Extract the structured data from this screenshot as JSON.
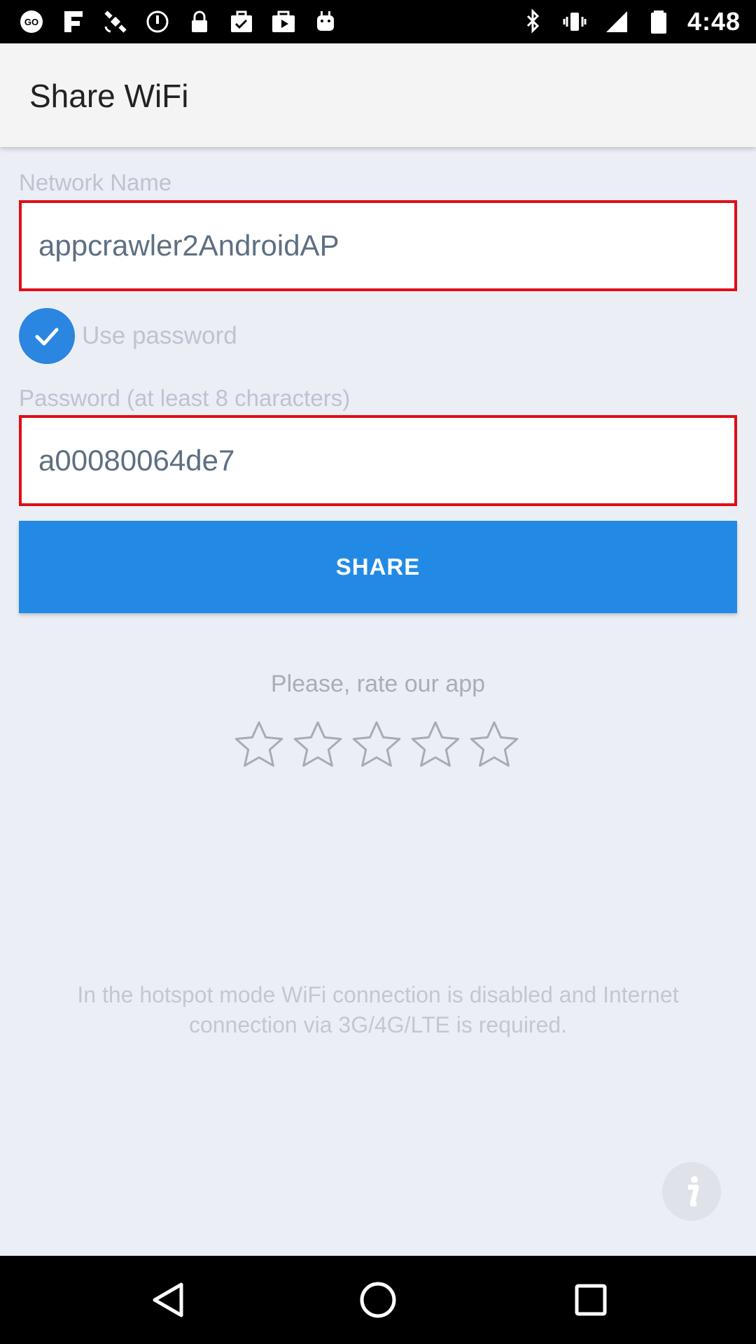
{
  "status_bar": {
    "time": "4:48",
    "left_icons": [
      "go-icon",
      "fake-gps-icon",
      "satellite-icon",
      "alarm-icon",
      "lock-icon",
      "briefcase-check-icon",
      "play-store-icon",
      "android-icon"
    ],
    "right_icons": [
      "bluetooth-icon",
      "vibrate-icon",
      "signal-icon",
      "battery-icon"
    ]
  },
  "app_bar": {
    "title": "Share WiFi"
  },
  "form": {
    "network_label": "Network Name",
    "network_value": "appcrawler2AndroidAP",
    "use_password_label": "Use password",
    "use_password_checked": true,
    "password_label": "Password (at least 8 characters)",
    "password_value": "a00080064de7",
    "share_button": "SHARE"
  },
  "rating": {
    "label": "Please, rate our app",
    "stars_total": 5,
    "stars_selected": 0
  },
  "info": {
    "text": "In the hotspot mode WiFi connection is disabled and Internet connection via 3G/4G/LTE is required."
  },
  "colors": {
    "accent": "#228ae4",
    "input_border": "#e00e16",
    "background": "#eceef6"
  }
}
